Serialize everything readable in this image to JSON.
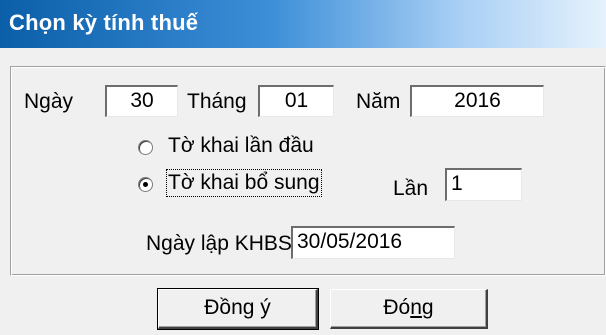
{
  "window": {
    "title": "Chọn kỳ tính thuế"
  },
  "period": {
    "day_label": "Ngày",
    "day_value": "30",
    "month_label": "Tháng",
    "month_value": "01",
    "year_label": "Năm",
    "year_value": "2016"
  },
  "declaration_type": {
    "options": [
      {
        "label": "Tờ khai lần đầu",
        "selected": false
      },
      {
        "label": "Tờ khai bổ sung",
        "selected": true
      }
    ],
    "attempt_label": "Lần",
    "attempt_value": "1"
  },
  "supplement": {
    "date_label": "Ngày lập KHBS",
    "date_value": "30/05/2016"
  },
  "buttons": {
    "ok_label": "Đồng ý",
    "close_prefix": "Đó",
    "close_mnemonic": "n",
    "close_suffix": "g"
  }
}
